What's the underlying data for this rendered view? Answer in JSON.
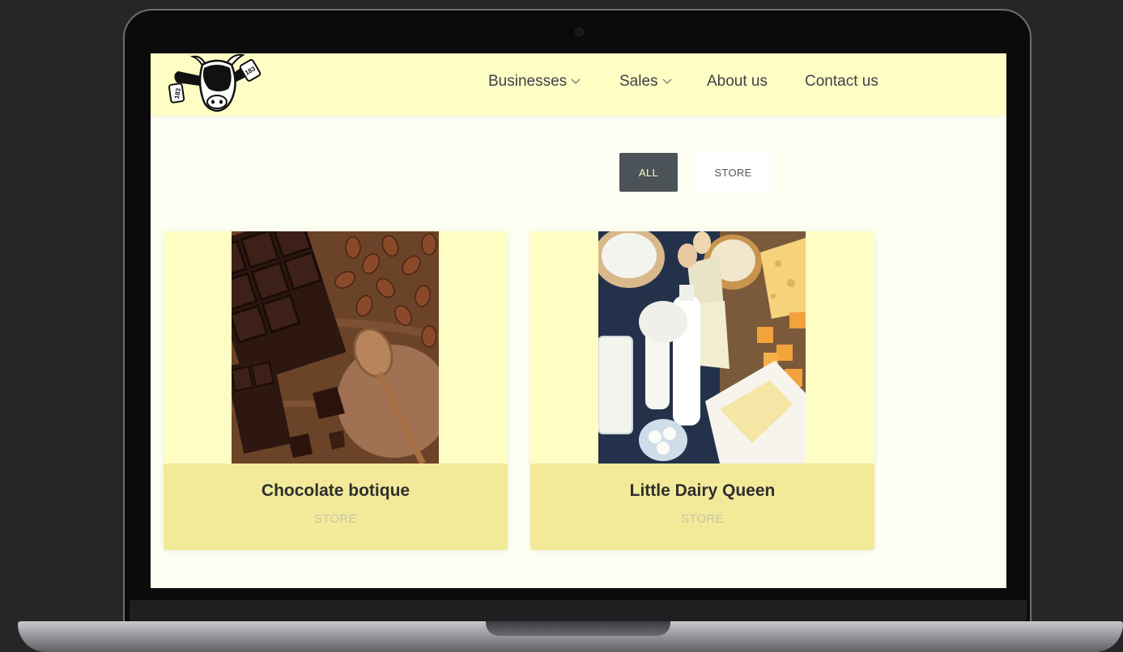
{
  "brand": {
    "logo_tag_left": "183",
    "logo_tag_right": "183"
  },
  "nav": {
    "items": [
      {
        "label": "Businesses",
        "has_dropdown": true
      },
      {
        "label": "Sales",
        "has_dropdown": true
      },
      {
        "label": "About us",
        "has_dropdown": false
      },
      {
        "label": "Contact us",
        "has_dropdown": false
      }
    ]
  },
  "filters": {
    "all_label": "ALL",
    "store_label": "STORE",
    "active": "ALL"
  },
  "cards": [
    {
      "title": "Chocolate botique",
      "category": "STORE",
      "image": "chocolate-image"
    },
    {
      "title": "Little Dairy Queen",
      "category": "STORE",
      "image": "dairy-image"
    }
  ],
  "colors": {
    "navbar_bg": "#fefec4",
    "page_bg": "#fefff3",
    "active_filter_bg": "#4b5258",
    "active_filter_text": "#fefec4",
    "card_footer_bg": "#f2ea99",
    "card_bg": "#fefec4"
  }
}
